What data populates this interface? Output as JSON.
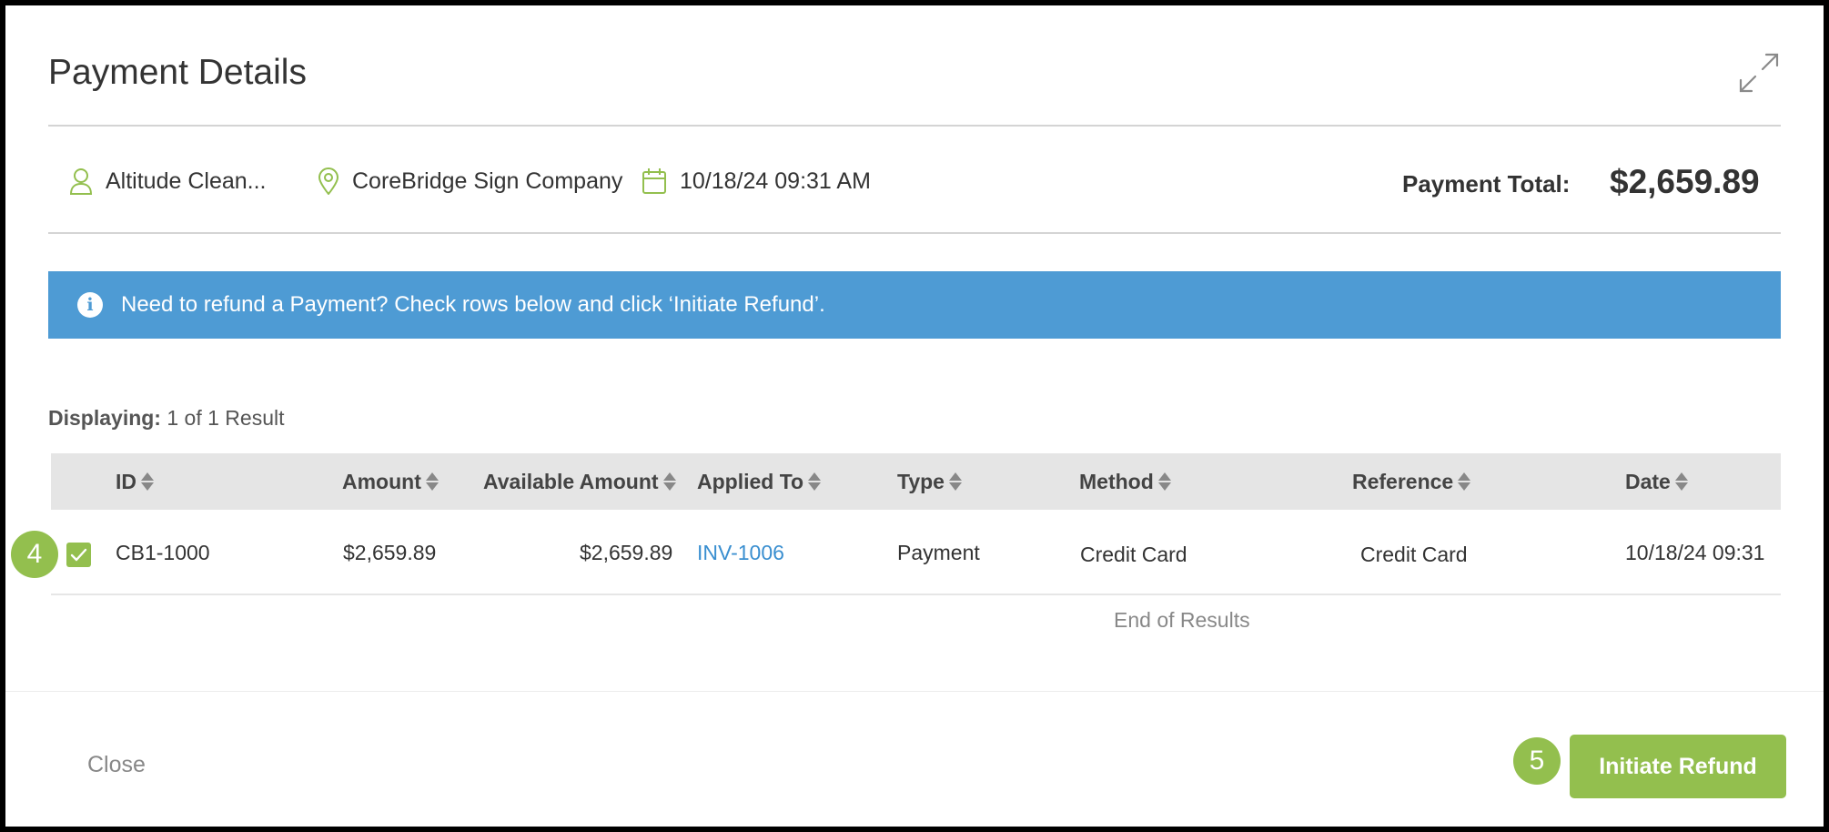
{
  "modal": {
    "title": "Payment Details"
  },
  "summary": {
    "customer": "Altitude Clean...",
    "location": "CoreBridge Sign Company",
    "datetime": "10/18/24 09:31 AM",
    "payment_total_label": "Payment Total:",
    "payment_total_value": "$2,659.89"
  },
  "info_bar": {
    "message": "Need to refund a Payment? Check rows below and click ‘Initiate Refund’."
  },
  "results": {
    "displaying_label": "Displaying:",
    "displaying_value": "1 of 1 Result",
    "end_of_results": "End of Results"
  },
  "table": {
    "headers": {
      "id": "ID",
      "amount": "Amount",
      "available_amount": "Available Amount",
      "applied_to": "Applied To",
      "type": "Type",
      "method": "Method",
      "reference": "Reference",
      "date": "Date"
    },
    "rows": [
      {
        "checked": true,
        "id": "CB1-1000",
        "amount": "$2,659.89",
        "available_amount": "$2,659.89",
        "applied_to": "INV-1006",
        "type": "Payment",
        "method": "Credit Card",
        "reference": "Credit Card",
        "date": "10/18/24 09:31"
      }
    ]
  },
  "footer": {
    "close_label": "Close",
    "refund_label": "Initiate Refund"
  },
  "step_badges": {
    "checkbox_step": "4",
    "refund_step": "5"
  },
  "colors": {
    "accent_green": "#93bf4e",
    "info_blue": "#4e9bd4",
    "link_blue": "#3a8fd0"
  },
  "icons": {
    "expand": "expand-icon",
    "customer": "user-icon",
    "location": "map-pin-icon",
    "date": "calendar-icon",
    "info": "info-icon",
    "sort": "sort-icon",
    "check": "check-icon"
  }
}
